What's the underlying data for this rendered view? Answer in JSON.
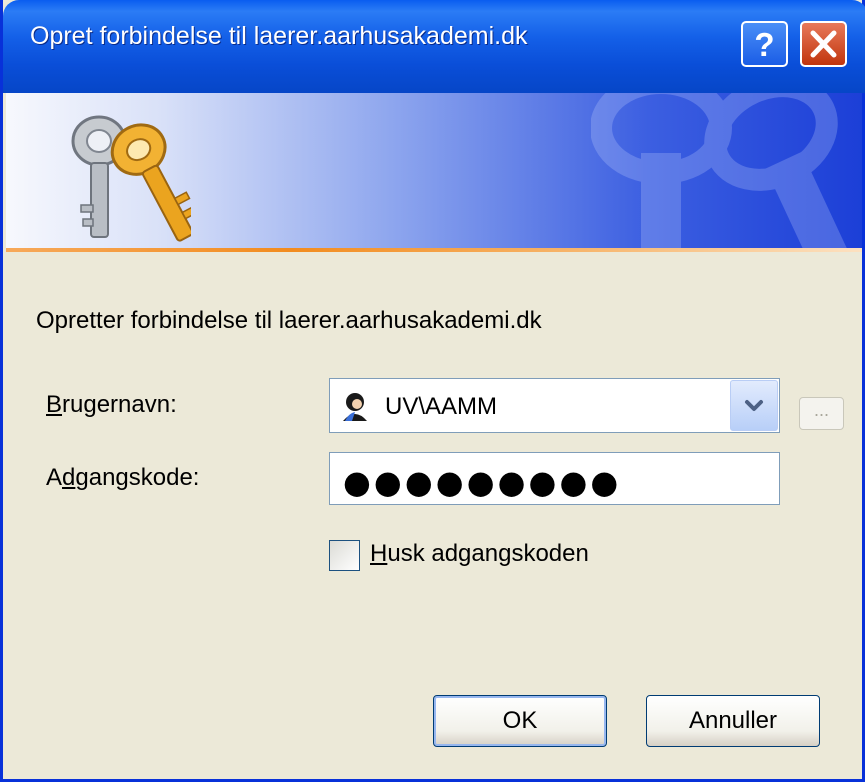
{
  "window": {
    "title": "Opret forbindelse til laerer.aarhusakademi.dk",
    "help_icon": "question-mark-icon",
    "close_icon": "close-x-icon"
  },
  "banner": {
    "icon": "keys-icon",
    "watermark": "keys-watermark-icon"
  },
  "message": "Opretter forbindelse til laerer.aarhusakademi.dk",
  "username": {
    "label_accel": "B",
    "label_rest": "rugernavn:",
    "value": "UV\\AAMM",
    "avatar_icon": "user-avatar-icon",
    "dropdown_icon": "chevron-down-icon",
    "browse_label": "..."
  },
  "password": {
    "label_pre": "A",
    "label_accel": "d",
    "label_rest": "gangskode:",
    "masked_value": "●●●●●●●●●"
  },
  "remember": {
    "checked": false,
    "label_accel": "H",
    "label_rest": "usk adgangskoden"
  },
  "buttons": {
    "ok": "OK",
    "cancel": "Annuller"
  },
  "colors": {
    "titlebar": "#0a4ed8",
    "dialog_bg": "#ece9d8",
    "banner_accent": "#f28c1f",
    "close_button": "#c1350d"
  }
}
